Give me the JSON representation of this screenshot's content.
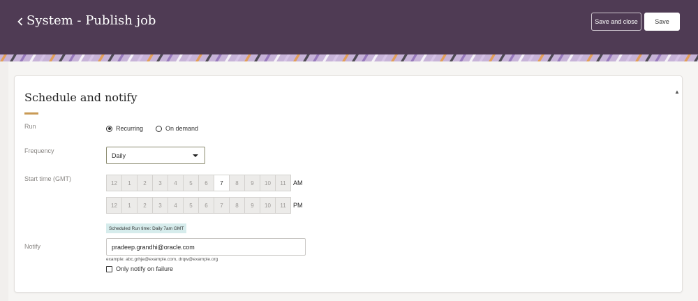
{
  "header": {
    "title": "System - Publish job",
    "save_close_label": "Save and close",
    "save_label": "Save",
    "bg_color": "#4f3b54"
  },
  "section": {
    "title": "Schedule and notify",
    "accent_color": "#c99a55"
  },
  "run": {
    "label": "Run",
    "options": [
      "Recurring",
      "On demand"
    ],
    "selected": "Recurring"
  },
  "frequency": {
    "label": "Frequency",
    "value": "Daily"
  },
  "start_time": {
    "label": "Start time (GMT)",
    "am_label": "AM",
    "pm_label": "PM",
    "hours": [
      "12",
      "1",
      "2",
      "3",
      "4",
      "5",
      "6",
      "7",
      "8",
      "9",
      "10",
      "11"
    ],
    "selected_am": "7",
    "hint": "Scheduled Run time: Daily 7am GMT"
  },
  "notify": {
    "label": "Notify",
    "value": "pradeep.grandhi@oracle.com",
    "example": "example: abc.grhje@example.com, drqw@example.org",
    "failure_label": "Only notify on failure"
  }
}
